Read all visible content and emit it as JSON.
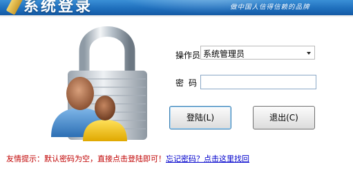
{
  "header": {
    "title": "系统登录",
    "tagline": "做中国人信得信赖的品牌",
    "colors": {
      "banner_top": "#3a8fd6",
      "banner_bottom": "#155aa4"
    },
    "logo_icon": "pen-icon"
  },
  "illustration": {
    "icon": "padlock-users-icon"
  },
  "form": {
    "operator_label": "操作员",
    "operator_value": "系统管理员",
    "password_label": "密码",
    "password_value": ""
  },
  "buttons": {
    "login_label": "登陆(L)",
    "exit_label": "退出(C)"
  },
  "footer": {
    "hint": "友情提示：默认密码为空，直接点击登陆即可！",
    "link": "忘记密码？点击这里找回",
    "colors": {
      "hint": "#c00000",
      "link": "#0000cc"
    }
  }
}
